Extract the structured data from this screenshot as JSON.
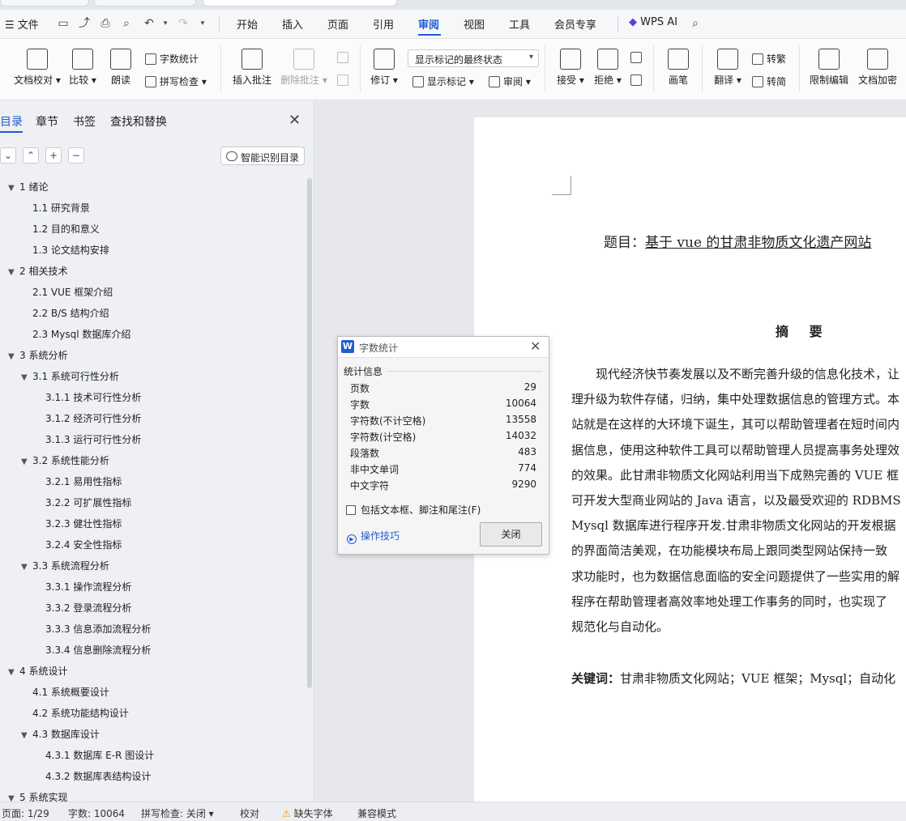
{
  "menu": {
    "file": "文件",
    "tabs": [
      "开始",
      "插入",
      "页面",
      "引用",
      "审阅",
      "视图",
      "工具",
      "会员专享"
    ],
    "active_tab": "审阅",
    "wps_ai": "WPS AI"
  },
  "ribbon": {
    "doc_check": "文档校对",
    "compare": "比较",
    "read_aloud": "朗读",
    "word_count": "字数统计",
    "spell_check": "拼写检查",
    "insert_comment": "插入批注",
    "delete_comment": "删除批注",
    "track_changes": "修订",
    "markup_dropdown": "显示标记的最终状态",
    "show_markup": "显示标记",
    "review": "审阅",
    "accept": "接受",
    "reject": "拒绝",
    "pen": "画笔",
    "translate": "翻译",
    "to_traditional": "转繁",
    "to_simplified": "转简",
    "restrict_edit": "限制编辑",
    "doc_encrypt": "文档加密"
  },
  "nav": {
    "tabs": [
      "目录",
      "章节",
      "书签",
      "查找和替换"
    ],
    "smart_toc": "智能识别目录",
    "toc": [
      {
        "label": "1  绪论",
        "level": 1,
        "expand": true
      },
      {
        "label": "1.1  研究背景",
        "level": 2,
        "expand": false
      },
      {
        "label": "1.2  目的和意义",
        "level": 2,
        "expand": false
      },
      {
        "label": "1.3  论文结构安排",
        "level": 2,
        "expand": false
      },
      {
        "label": "2  相关技术",
        "level": 1,
        "expand": true
      },
      {
        "label": "2.1 VUE 框架介绍",
        "level": 2,
        "expand": false
      },
      {
        "label": "2.2 B/S 结构介绍",
        "level": 2,
        "expand": false
      },
      {
        "label": "2.3 Mysql 数据库介绍",
        "level": 2,
        "expand": false
      },
      {
        "label": "3  系统分析",
        "level": 1,
        "expand": true
      },
      {
        "label": "3.1  系统可行性分析",
        "level": 2,
        "expand": true
      },
      {
        "label": "3.1.1  技术可行性分析",
        "level": 3,
        "expand": false
      },
      {
        "label": "3.1.2  经济可行性分析",
        "level": 3,
        "expand": false
      },
      {
        "label": "3.1.3  运行可行性分析",
        "level": 3,
        "expand": false
      },
      {
        "label": "3.2  系统性能分析",
        "level": 2,
        "expand": true
      },
      {
        "label": "3.2.1  易用性指标",
        "level": 3,
        "expand": false
      },
      {
        "label": "3.2.2  可扩展性指标",
        "level": 3,
        "expand": false
      },
      {
        "label": "3.2.3  健壮性指标",
        "level": 3,
        "expand": false
      },
      {
        "label": "3.2.4  安全性指标",
        "level": 3,
        "expand": false
      },
      {
        "label": "3.3  系统流程分析",
        "level": 2,
        "expand": true
      },
      {
        "label": "3.3.1  操作流程分析",
        "level": 3,
        "expand": false
      },
      {
        "label": "3.3.2  登录流程分析",
        "level": 3,
        "expand": false
      },
      {
        "label": "3.3.3  信息添加流程分析",
        "level": 3,
        "expand": false
      },
      {
        "label": "3.3.4  信息删除流程分析",
        "level": 3,
        "expand": false
      },
      {
        "label": "4  系统设计",
        "level": 1,
        "expand": true
      },
      {
        "label": "4.1  系统概要设计",
        "level": 2,
        "expand": false
      },
      {
        "label": "4.2  系统功能结构设计",
        "level": 2,
        "expand": false
      },
      {
        "label": "4.3  数据库设计",
        "level": 2,
        "expand": true
      },
      {
        "label": "4.3.1  数据库 E-R 图设计",
        "level": 3,
        "expand": false
      },
      {
        "label": "4.3.2  数据库表结构设计",
        "level": 3,
        "expand": false
      },
      {
        "label": "5  系统实现",
        "level": 1,
        "expand": true
      }
    ]
  },
  "document": {
    "title_prefix": "题目：",
    "title_main": "基于 vue 的甘肃非物质文化遗产网站",
    "abstract_heading": "摘  要",
    "lines": [
      "现代经济快节奏发展以及不断完善升级的信息化技术，让",
      "理升级为软件存储，归纳，集中处理数据信息的管理方式。本",
      "站就是在这样的大环境下诞生，其可以帮助管理者在短时间内",
      "据信息，使用这种软件工具可以帮助管理人员提高事务处理效",
      "的效果。此甘肃非物质文化网站利用当下成熟完善的 VUE 框",
      "可开发大型商业网站的 Java 语言，以及最受欢迎的 RDBMS",
      "Mysql 数据库进行程序开发.甘肃非物质文化网站的开发根据",
      "的界面简洁美观，在功能模块布局上跟同类型网站保持一致",
      "求功能时，也为数据信息面临的安全问题提供了一些实用的解",
      "程序在帮助管理者高效率地处理工作事务的同时，也实现了",
      "规范化与自动化。"
    ],
    "keywords_label": "关键词：",
    "keywords": "甘肃非物质文化网站；VUE 框架；Mysql；自动化"
  },
  "dialog": {
    "title": "字数统计",
    "section": "统计信息",
    "rows": [
      {
        "label": "页数",
        "value": "29"
      },
      {
        "label": "字数",
        "value": "10064"
      },
      {
        "label": "字符数(不计空格)",
        "value": "13558"
      },
      {
        "label": "字符数(计空格)",
        "value": "14032"
      },
      {
        "label": "段落数",
        "value": "483"
      },
      {
        "label": "非中文单词",
        "value": "774"
      },
      {
        "label": "中文字符",
        "value": "9290"
      }
    ],
    "include_label": "包括文本框、脚注和尾注(F)",
    "tips": "操作技巧",
    "close": "关闭"
  },
  "status": {
    "page": "页面: 1/29",
    "words": "字数: 10064",
    "spell": "拼写检查: 关闭",
    "proof": "校对",
    "missing_font": "缺失字体",
    "compat": "兼容模式"
  },
  "colors": {
    "accent": "#1f5bd6",
    "warning": "#e8a000"
  }
}
